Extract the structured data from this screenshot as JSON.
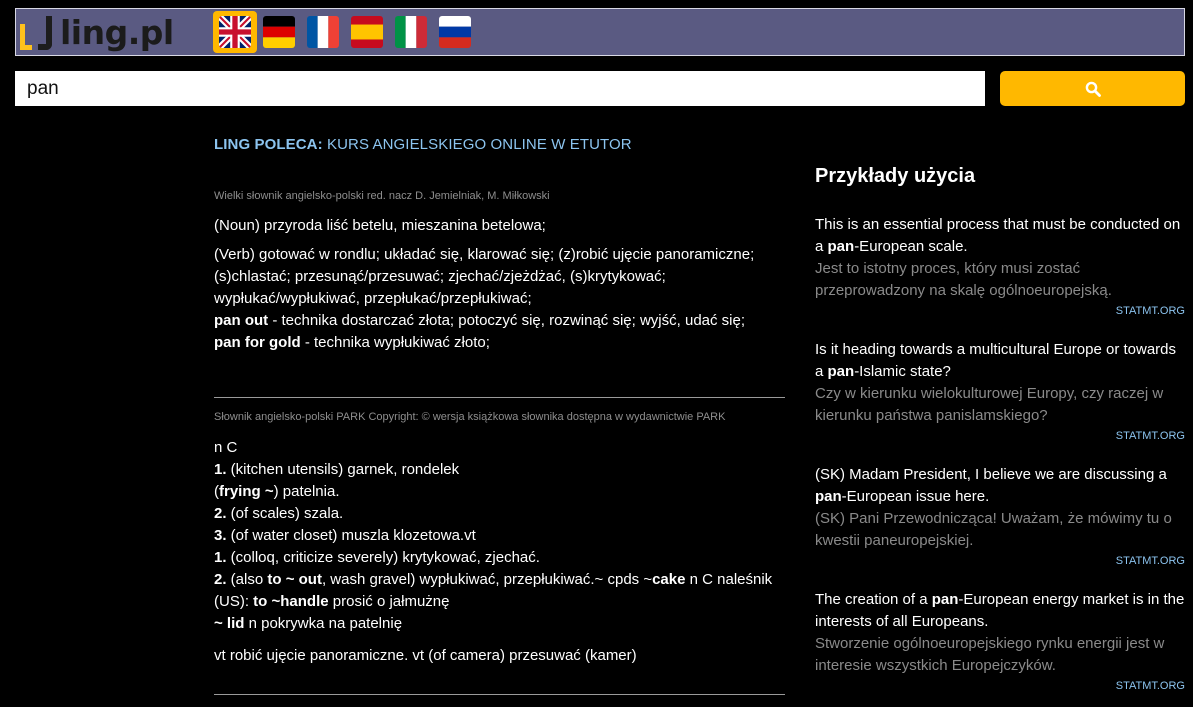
{
  "logo": {
    "text": "ling.pl"
  },
  "languages": [
    {
      "name": "en-flag-icon",
      "active": true
    },
    {
      "name": "de-flag-icon",
      "active": false
    },
    {
      "name": "fr-flag-icon",
      "active": false
    },
    {
      "name": "es-flag-icon",
      "active": false
    },
    {
      "name": "it-flag-icon",
      "active": false
    },
    {
      "name": "ru-flag-icon",
      "active": false
    }
  ],
  "search": {
    "value": "pan",
    "button_icon": "search-icon"
  },
  "promo": {
    "label": "LING POLECA:",
    "text": "KURS ANGIELSKIEGO ONLINE W ETUTOR"
  },
  "dict1": {
    "source": "Wielki słownik angielsko-polski red. nacz D. Jemielniak, M. Miłkowski",
    "noun": "(Noun) przyroda liść betelu, mieszanina betelowa;",
    "verb": "(Verb) gotować w rondlu; układać się, klarować się; (z)robić ujęcie panoramiczne; (s)chlastać; przesunąć/przesuwać; zjechać/zjeżdżać, (s)krytykować; wypłukać/wypłukiwać, przepłukać/przepłukiwać;",
    "phrase1_term": "pan out",
    "phrase1_def": " - technika dostarczać złota; potoczyć się, rozwinąć się; wyjść, udać się;",
    "phrase2_term": "pan for gold",
    "phrase2_def": " - technika wypłukiwać złoto;"
  },
  "dict2": {
    "source": "Słownik angielsko-polski PARK Copyright: © wersja książkowa słownika dostępna w wydawnictwie PARK",
    "l1": "n C",
    "l2_num": "1.",
    "l2": " (kitchen utensils) garnek, rondelek",
    "l3_open": "(",
    "l3_bold": "frying ~",
    "l3": ") patelnia.",
    "l4_num": "2.",
    "l4": " (of scales) szala.",
    "l5_num": "3.",
    "l5": " (of water closet) muszla klozetowa.vt",
    "l6_num": "1.",
    "l6": " (colloq, criticize severely) krytykować, zjechać.",
    "l7_num": "2.",
    "l7_a": " (also ",
    "l7_b": "to ~ out",
    "l7_c": ", wash gravel) wypłukiwać, przepłukiwać.~ cpds ~",
    "l7_d": "cake",
    "l7_e": " n C naleśnik (US): ",
    "l7_f": "to ~handle",
    "l7_g": " prosić o jałmużnę",
    "l8_bold": "~ lid",
    "l8": " n pokrywka na patelnię",
    "l9": "vt robić ujęcie panoramiczne. vt (of camera) przesuwać (kamer)"
  },
  "examples": {
    "title": "Przykłady użycia",
    "items": [
      {
        "en_pre": "This is an essential process that must be conducted on a ",
        "en_bold": "pan",
        "en_post": "-European scale.",
        "pl": "Jest to istotny proces, który musi zostać przeprowadzony na skalę ogólnoeuropejską.",
        "src": "STATMT.ORG"
      },
      {
        "en_pre": "Is it heading towards a multicultural Europe or towards a ",
        "en_bold": "pan",
        "en_post": "-Islamic state?",
        "pl": "Czy w kierunku wielokulturowej Europy, czy raczej w kierunku państwa panislamskiego?",
        "src": "STATMT.ORG"
      },
      {
        "en_pre": "(SK) Madam President, I believe we are discussing a ",
        "en_bold": "pan",
        "en_post": "-European issue here.",
        "pl": "(SK) Pani Przewodnicząca! Uważam, że mówimy tu o kwestii paneuropejskiej.",
        "src": "STATMT.ORG"
      },
      {
        "en_pre": "The creation of a ",
        "en_bold": "pan",
        "en_post": "-European energy market is in the interests of all Europeans.",
        "pl": "Stworzenie ogólnoeuropejskiego rynku energii jest w interesie wszystkich Europejczyków.",
        "src": "STATMT.ORG"
      }
    ]
  }
}
